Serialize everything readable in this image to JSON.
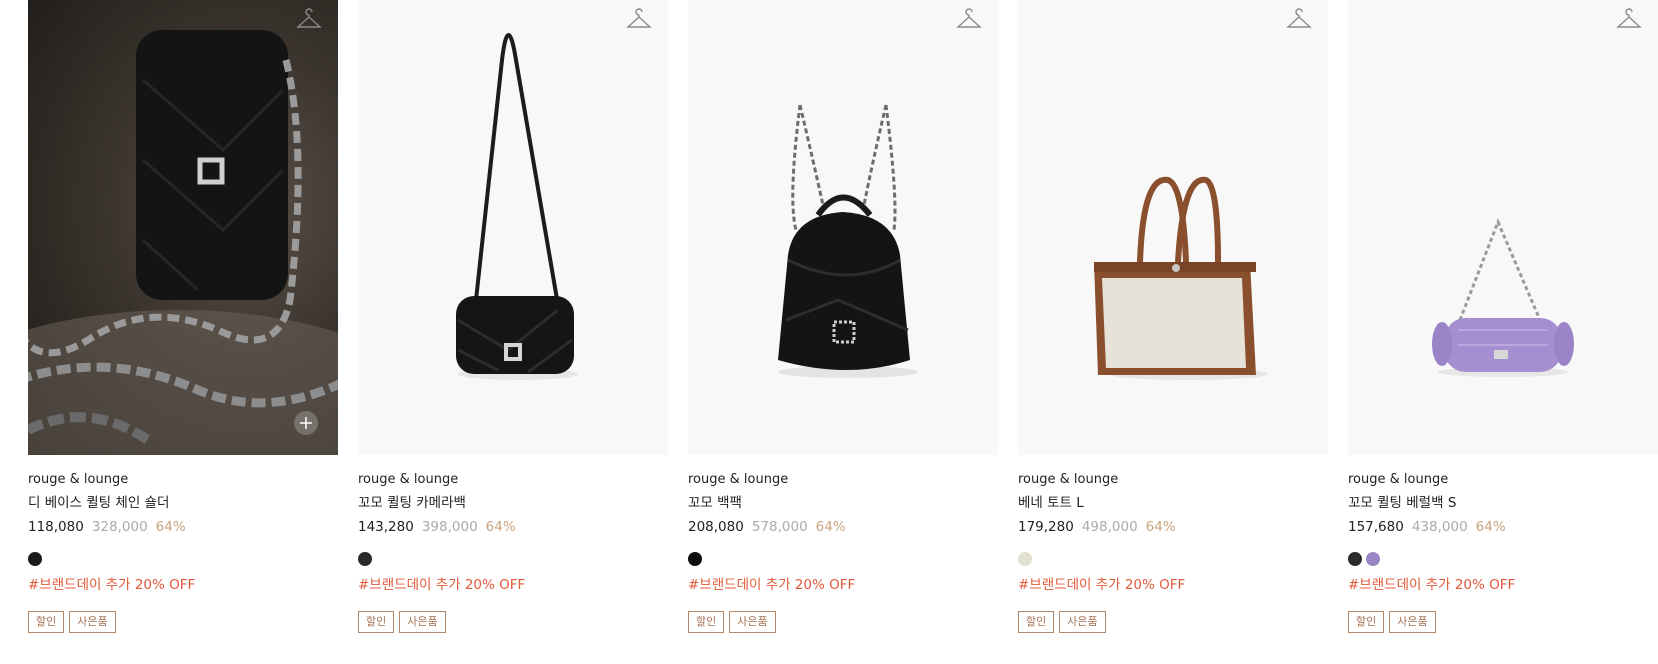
{
  "products": [
    {
      "brand": "rouge & lounge",
      "name": "디 베이스 퀼팅 체인 숄더",
      "price": "118,080",
      "original_price": "328,000",
      "discount_rate": "64%",
      "swatches": [
        "#1a1a1a"
      ],
      "promo": "#브랜드데이 추가 20% OFF",
      "tags": [
        "할인",
        "사은품"
      ]
    },
    {
      "brand": "rouge & lounge",
      "name": "꼬모 퀼팅 카메라백",
      "price": "143,280",
      "original_price": "398,000",
      "discount_rate": "64%",
      "swatches": [
        "#2a2a2a"
      ],
      "promo": "#브랜드데이 추가 20% OFF",
      "tags": [
        "할인",
        "사은품"
      ]
    },
    {
      "brand": "rouge & lounge",
      "name": "꼬모 백팩",
      "price": "208,080",
      "original_price": "578,000",
      "discount_rate": "64%",
      "swatches": [
        "#0d0d0d"
      ],
      "promo": "#브랜드데이 추가 20% OFF",
      "tags": [
        "할인",
        "사은품"
      ]
    },
    {
      "brand": "rouge & lounge",
      "name": "베네 토트 L",
      "price": "179,280",
      "original_price": "498,000",
      "discount_rate": "64%",
      "swatches": [
        "#e2e0d0"
      ],
      "promo": "#브랜드데이 추가 20% OFF",
      "tags": [
        "할인",
        "사은품"
      ]
    },
    {
      "brand": "rouge & lounge",
      "name": "꼬모 퀼팅 베럴백 S",
      "price": "157,680",
      "original_price": "438,000",
      "discount_rate": "64%",
      "swatches": [
        "#2b2b2b",
        "#9a86c4"
      ],
      "promo": "#브랜드데이 추가 20% OFF",
      "tags": [
        "할인",
        "사은품"
      ]
    }
  ],
  "icons": {
    "wishlist": "hanger-icon",
    "quick_add": "plus-icon"
  },
  "colors": {
    "promo": "#e25a3a",
    "discount": "#c9a37f",
    "tag_border": "#b58a6a"
  }
}
